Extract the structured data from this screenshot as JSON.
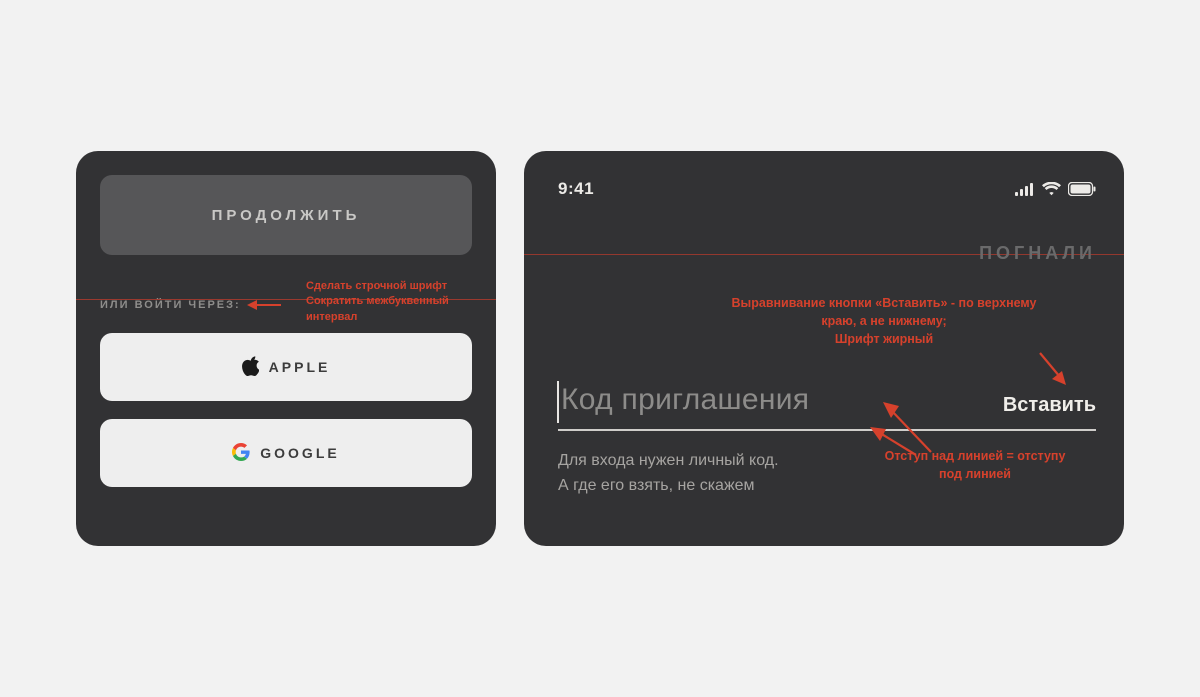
{
  "left": {
    "continue_label": "ПРОДОЛЖИТЬ",
    "or_label": "ИЛИ ВОЙТИ ЧЕРЕЗ:",
    "annotation_line1": "Сделать строчной шрифт",
    "annotation_line2": "Сократить межбуквенный интервал",
    "apple_label": "APPLE",
    "google_label": "GOOGLE"
  },
  "right": {
    "clock": "9:41",
    "pognali": "ПОГНАЛИ",
    "annotation_top_line1": "Выравнивание кнопки «Вставить» -  по верхнему",
    "annotation_top_line2": "краю, а не нижнему;",
    "annotation_top_line3": "Шрифт жирный",
    "code_placeholder": "Код приглашения",
    "paste_label": "Вставить",
    "help_line1": "Для входа нужен личный код.",
    "help_line2": "А где его взять, не скажем",
    "annotation_bottom_line1": "Отступ над линией = отступу",
    "annotation_bottom_line2": "под линией"
  },
  "colors": {
    "annotation": "#d6412c",
    "panel_bg": "#323234"
  }
}
